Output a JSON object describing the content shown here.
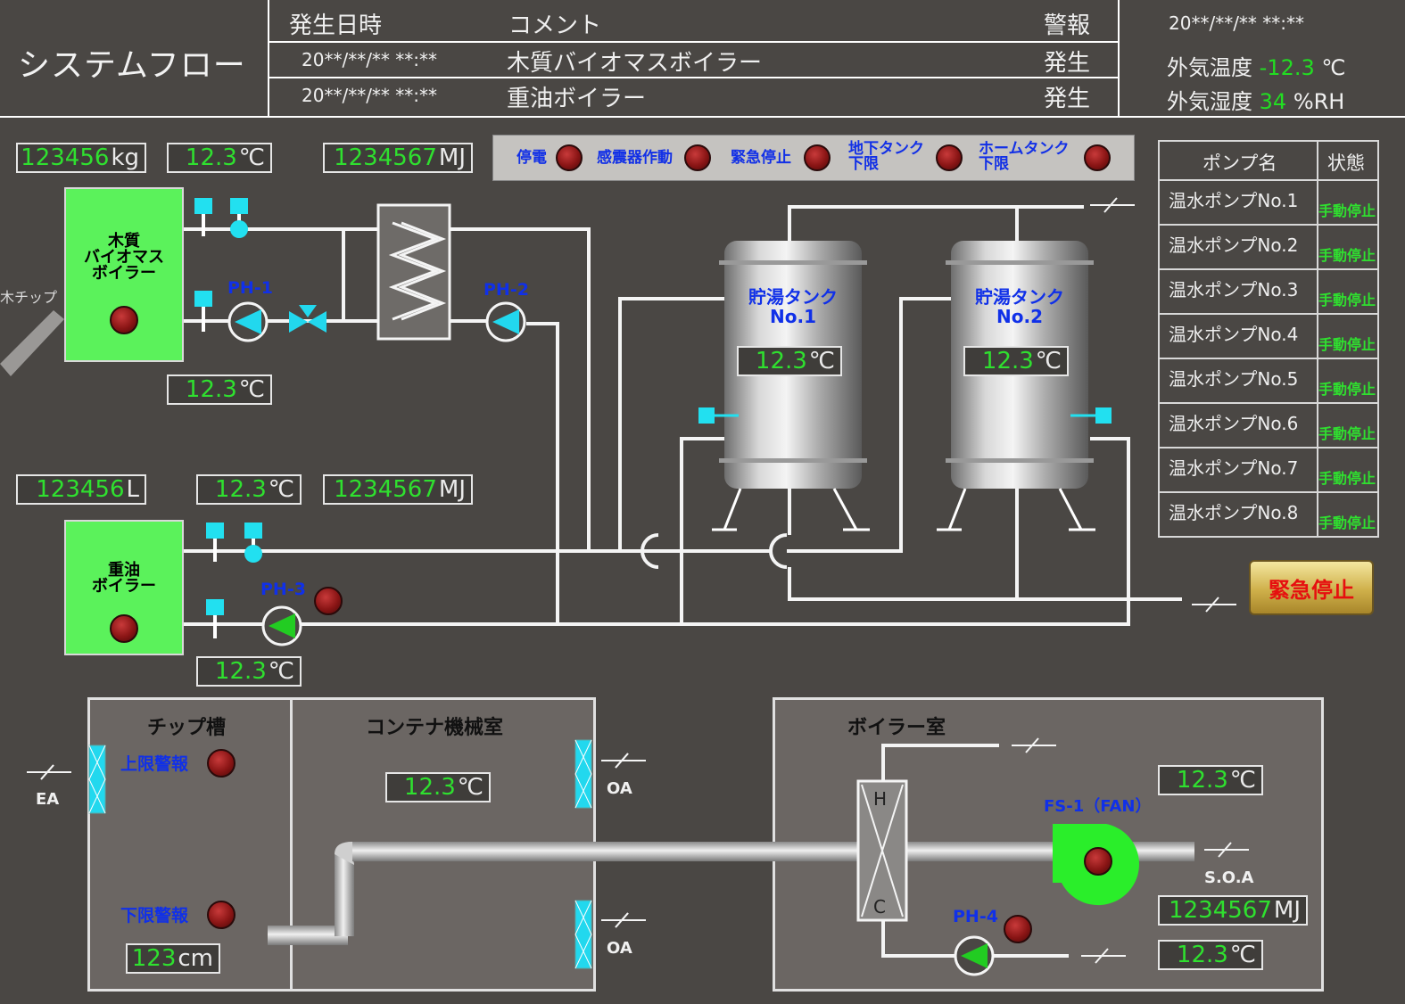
{
  "header": {
    "title": "システムフロー",
    "alarm_columns": {
      "date": "発生日時",
      "comment": "コメント",
      "alarm": "警報"
    },
    "alarms": [
      {
        "date": "20**/**/**  **:**",
        "comment": "木質バイオマスボイラー",
        "status": "発生"
      },
      {
        "date": "20**/**/**  **:**",
        "comment": "重油ボイラー",
        "status": "発生"
      }
    ],
    "datetime": "20**/**/**  **:**",
    "outdoor_temp_label": "外気温度",
    "outdoor_temp_value": "-12.3",
    "outdoor_temp_unit": "℃",
    "outdoor_humidity_label": "外気湿度",
    "outdoor_humidity_value": "34",
    "outdoor_humidity_unit": "%RH"
  },
  "status_panel": {
    "items": [
      "停電",
      "感震器作動",
      "緊急停止",
      "地下タンク\n下限",
      "ホームタンク\n下限"
    ]
  },
  "biomass": {
    "name": "木質\nバイオマス\nボイラー",
    "chip_label": "木チップ",
    "weight": {
      "value": "123456",
      "unit": "kg"
    },
    "temp": {
      "value": "12.3",
      "unit": "℃"
    },
    "energy": {
      "value": "1234567",
      "unit": "MJ"
    },
    "return_temp": {
      "value": "12.3",
      "unit": "℃"
    },
    "pump1": "PH-1",
    "pump2": "PH-2"
  },
  "oil": {
    "name": "重油\nボイラー",
    "volume": {
      "value": "123456",
      "unit": "L"
    },
    "temp": {
      "value": "12.3",
      "unit": "℃"
    },
    "energy": {
      "value": "1234567",
      "unit": "MJ"
    },
    "return_temp": {
      "value": "12.3",
      "unit": "℃"
    },
    "pump3": "PH-3"
  },
  "tanks": [
    {
      "name": "貯湯タンク\nNo.1",
      "temp": "12.3",
      "unit": "℃"
    },
    {
      "name": "貯湯タンク\nNo.2",
      "temp": "12.3",
      "unit": "℃"
    }
  ],
  "pump_table": {
    "col_name": "ポンプ名",
    "col_state": "状態",
    "rows": [
      {
        "name": "温水ポンプNo.1",
        "state": "手動停止"
      },
      {
        "name": "温水ポンプNo.2",
        "state": "手動停止"
      },
      {
        "name": "温水ポンプNo.3",
        "state": "手動停止"
      },
      {
        "name": "温水ポンプNo.4",
        "state": "手動停止"
      },
      {
        "name": "温水ポンプNo.5",
        "state": "手動停止"
      },
      {
        "name": "温水ポンプNo.6",
        "state": "手動停止"
      },
      {
        "name": "温水ポンプNo.7",
        "state": "手動停止"
      },
      {
        "name": "温水ポンプNo.8",
        "state": "手動停止"
      }
    ]
  },
  "emergency_stop_label": "緊急停止",
  "chip_room": {
    "title": "チップ槽",
    "upper_alarm": "上限警報",
    "lower_alarm": "下限警報",
    "level": {
      "value": "123",
      "unit": "cm"
    },
    "ea_label": "EA"
  },
  "container_room": {
    "title": "コンテナ機械室",
    "temp": {
      "value": "12.3",
      "unit": "℃"
    },
    "oa_label_1": "OA",
    "oa_label_2": "OA"
  },
  "boiler_room": {
    "title": "ボイラー室",
    "fan_label": "FS-1（FAN）",
    "pump_label": "PH-4",
    "hx_h": "H",
    "hx_c": "C",
    "temp1": {
      "value": "12.3",
      "unit": "℃"
    },
    "energy": {
      "value": "1234567",
      "unit": "MJ"
    },
    "temp2": {
      "value": "12.3",
      "unit": "℃"
    },
    "soa_label": "S.O.A"
  },
  "colors": {
    "background": "#4a4744",
    "value_green": "#2fe02f",
    "boiler_green": "#5bf25b",
    "label_blue": "#1030e8",
    "alarm_red": "#8a1515"
  }
}
